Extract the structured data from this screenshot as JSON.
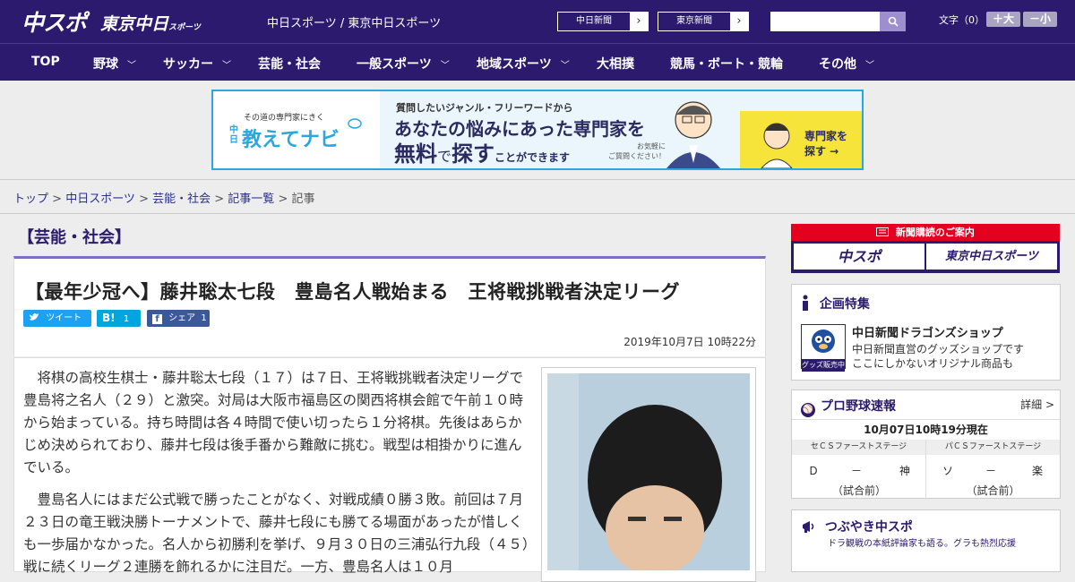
{
  "header": {
    "logo_main": "中スポ",
    "logo_sub": "東京中日",
    "logo_sub_small": "スポーツ",
    "site_title": "中日スポーツ / 東京中日スポーツ",
    "papers": [
      "中日新聞",
      "東京新聞"
    ],
    "font_label": "文字（0）",
    "font_up": "＋大",
    "font_down": "－小"
  },
  "nav": [
    {
      "label": "TOP",
      "has_menu": false
    },
    {
      "label": "野球",
      "has_menu": true
    },
    {
      "label": "サッカー",
      "has_menu": true
    },
    {
      "label": "芸能・社会",
      "has_menu": false
    },
    {
      "label": "一般スポーツ",
      "has_menu": true
    },
    {
      "label": "地域スポーツ",
      "has_menu": true
    },
    {
      "label": "大相撲",
      "has_menu": false
    },
    {
      "label": "競馬・ボート・競輪",
      "has_menu": false
    },
    {
      "label": "その他",
      "has_menu": true
    }
  ],
  "ad": {
    "tagline": "その道の専門家にきく",
    "brand_prefix": "中日",
    "brand": "教えてナビ",
    "line1": "質問したいジャンル・フリーワードから",
    "line2": "あなたの悩みにあった専門家を",
    "line3_a": "無料",
    "line3_b": "で",
    "line3_c": "探す",
    "line3_d": "ことができます",
    "note": "お気軽に\nご質問ください！",
    "cta": "専門家を\n探す →"
  },
  "breadcrumb": [
    "トップ",
    "中日スポーツ",
    "芸能・社会",
    "記事一覧",
    "記事"
  ],
  "article": {
    "genre": "【芸能・社会】",
    "title": "【最年少冠へ】藤井聡太七段　豊島名人戦始まる　王将戦挑戦者決定リーグ",
    "share": {
      "tweet": "ツイート",
      "hatena_label": "B!",
      "hatena_count": "1",
      "fb_label": "シェア",
      "fb_count": "1"
    },
    "date": "2019年10月7日 10時22分",
    "paragraphs": [
      "将棋の高校生棋士・藤井聡太七段（１７）は７日、王将戦挑戦者決定リーグで豊島将之名人（２９）と激突。対局は大阪市福島区の関西将棋会館で午前１０時から始まっている。持ち時間は各４時間で使い切ったら１分将棋。先後はあらかじめ決められており、藤井七段は後手番から難敵に挑む。戦型は相掛かりに進んでいる。",
      "豊島名人にはまだ公式戦で勝ったことがなく、対戦成績０勝３敗。前回は７月２３日の竜王戦決勝トーナメントで、藤井七段にも勝てる場面があったが惜しくも一歩届かなかった。名人から初勝利を挙げ、９月３０日の三浦弘行九段（４５）戦に続くリーグ２連勝を飾れるかに注目だ。一方、豊島名人は１０月"
    ]
  },
  "sidebar": {
    "promo_title": "新聞購読のご案内",
    "promo_logos": [
      "中スポ",
      "東京中日スポーツ"
    ],
    "special": {
      "title": "企画特集",
      "badge": "グッズ販売中",
      "item_title": "中日新聞ドラゴンズショップ",
      "item_lines": [
        "中日新聞直営のグッズショップです",
        "ここにしかないオリジナル商品も"
      ]
    },
    "baseball": {
      "title": "プロ野球速報",
      "detail": "詳細 >",
      "timestamp": "10月07日10時19分現在",
      "games": [
        {
          "stage": "セＣＳファーストステージ",
          "home": "Ｄ",
          "score": "－",
          "away": "神",
          "status": "（試合前）"
        },
        {
          "stage": "パＣＳファーストステージ",
          "home": "ソ",
          "score": "－",
          "away": "楽",
          "status": "（試合前）"
        }
      ]
    },
    "tweets": {
      "title": "つぶやき中スポ",
      "subtitle": "ドラ観戦の本紙評論家も語る。グラも熱烈応援"
    }
  }
}
